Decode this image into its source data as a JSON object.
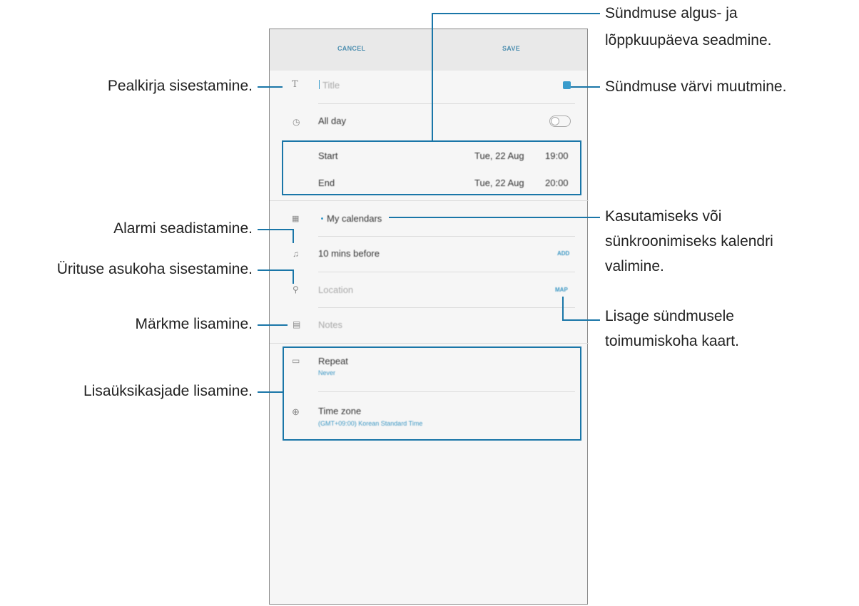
{
  "app": {
    "cancel_label": "CANCEL",
    "save_label": "SAVE",
    "title_placeholder": "Title",
    "all_day_label": "All day",
    "start_label": "Start",
    "start_date": "Tue, 22 Aug",
    "start_time": "19:00",
    "end_label": "End",
    "end_date": "Tue, 22 Aug",
    "end_time": "20:00",
    "calendar_label": "My calendars",
    "reminder_label": "10 mins before",
    "reminder_add": "ADD",
    "location_placeholder": "Location",
    "map_label": "MAP",
    "notes_placeholder": "Notes",
    "repeat_label": "Repeat",
    "repeat_value": "Never",
    "timezone_label": "Time zone",
    "timezone_value": "(GMT+09:00) Korean Standard Time"
  },
  "annotations": {
    "title_input": "Pealkirja sisestamine.",
    "alarm": "Alarmi seadistamine.",
    "location": "Ürituse asukoha sisestamine.",
    "notes": "Märkme lisamine.",
    "details": "Lisaüksikasjade lisamine.",
    "dates_line1": "Sündmuse algus- ja",
    "dates_line2": "lõppkuupäeva seadmine.",
    "color": "Sündmuse värvi muutmine.",
    "calendar_line1": "Kasutamiseks või",
    "calendar_line2": "sünkroonimiseks kalendri",
    "calendar_line3": "valimine.",
    "map_line1": "Lisage sündmusele",
    "map_line2": "toimumiskoha kaart."
  },
  "colors": {
    "accent": "#1a76a8",
    "event_color": "#3a9ccc"
  },
  "icons": [
    "text-icon",
    "clock-icon",
    "calendar-icon",
    "bell-icon",
    "location-pin-icon",
    "notes-icon",
    "repeat-icon",
    "globe-icon"
  ]
}
